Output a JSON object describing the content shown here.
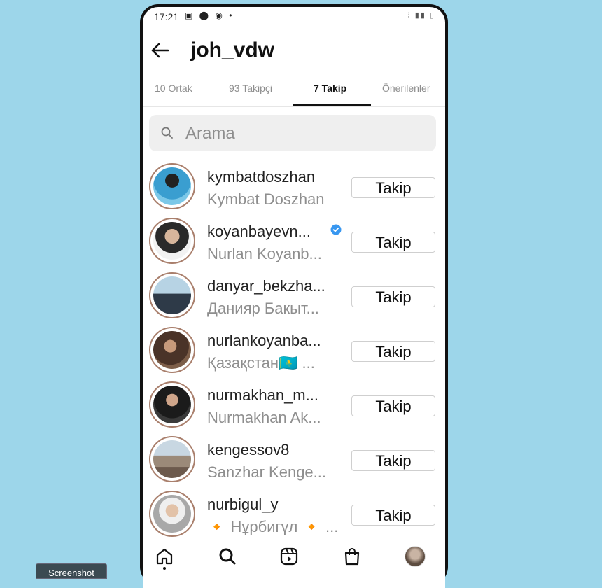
{
  "status_bar": {
    "time": "17:21",
    "left_icons": "▣ ⬤ ◉ •",
    "right_icons": "⁝ ▮▮ ▯"
  },
  "header": {
    "title": "joh_vdw",
    "back_icon": "arrow-left-icon"
  },
  "tabs": [
    {
      "label": "10 Ortak",
      "active": false
    },
    {
      "label": "93 Takipçi",
      "active": false
    },
    {
      "label": "7 Takip",
      "active": true
    },
    {
      "label": "Önerilenler",
      "active": false
    }
  ],
  "search": {
    "placeholder": "Arama",
    "value": ""
  },
  "following": [
    {
      "username": "kymbatdoszhan",
      "name": "Kymbat Doszhan",
      "verified": false,
      "button": "Takip"
    },
    {
      "username": "koyanbayevn...",
      "name": "Nurlan Koyanb...",
      "verified": true,
      "button": "Takip"
    },
    {
      "username": "danyar_bekzha...",
      "name": "Данияр Бакыт...",
      "verified": false,
      "button": "Takip"
    },
    {
      "username": "nurlankoyanba...",
      "name": "Қазақстан🇰🇿 ...",
      "verified": false,
      "button": "Takip"
    },
    {
      "username": "nurmakhan_m...",
      "name": "Nurmakhan Ak...",
      "verified": false,
      "button": "Takip"
    },
    {
      "username": "kengessov8",
      "name": "Sanzhar Kenge...",
      "verified": false,
      "button": "Takip"
    },
    {
      "username": "nurbigul_y",
      "name": "🔸 Нұрбигүл 🔸 ...",
      "verified": false,
      "button": "Takip"
    }
  ],
  "bottom_nav": [
    "home-icon",
    "search-icon",
    "reels-icon",
    "shop-icon",
    "profile-avatar"
  ],
  "overlay": {
    "screenshot_label": "Screenshot"
  },
  "colors": {
    "background": "#9dd6ea",
    "verified": "#3897f0",
    "muted_text": "#8e8e8e"
  }
}
